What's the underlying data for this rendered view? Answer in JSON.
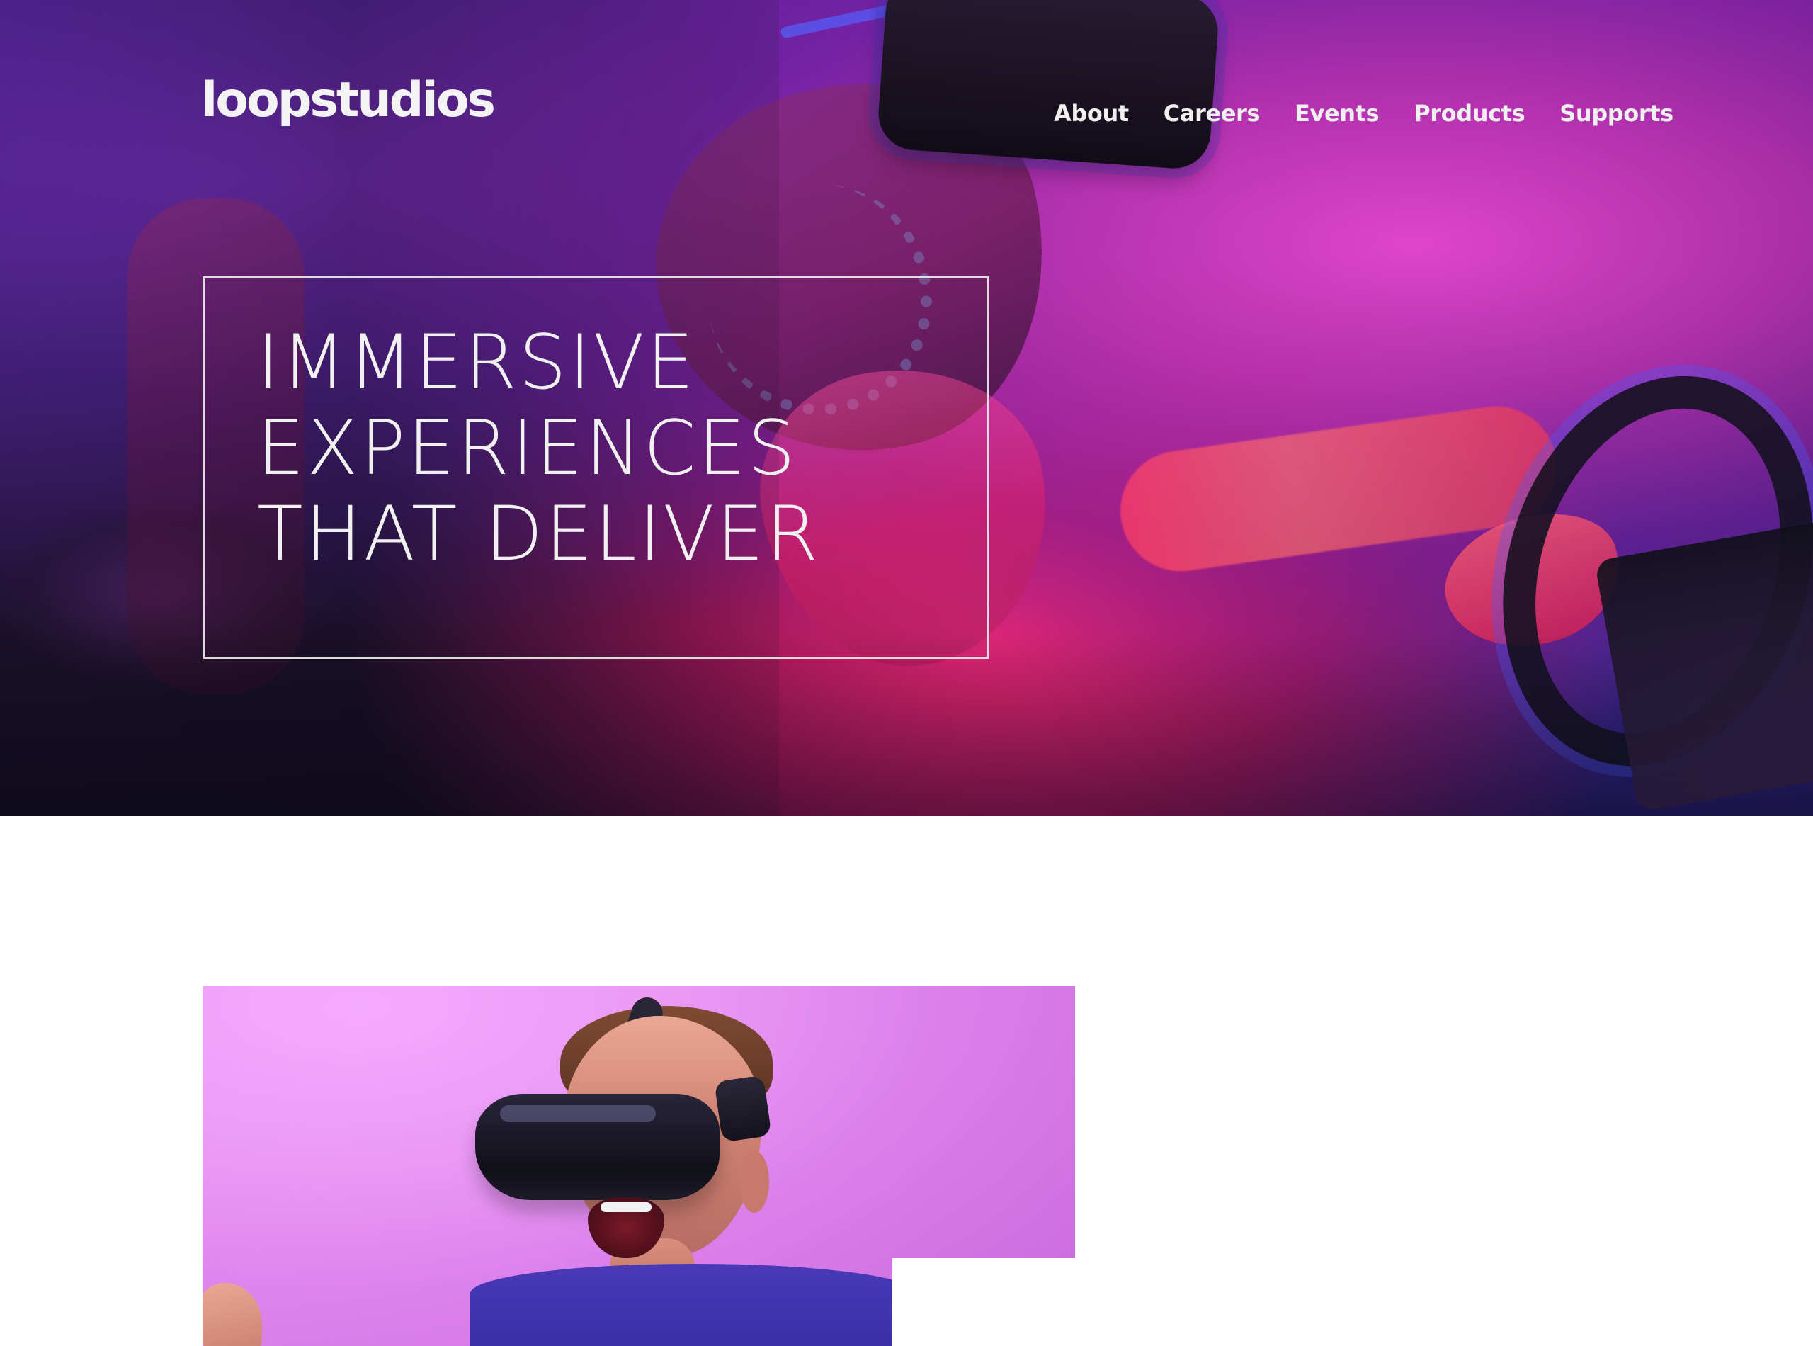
{
  "brand": {
    "logo_text": "loopstudios"
  },
  "nav": {
    "items": [
      {
        "label": "About"
      },
      {
        "label": "Careers"
      },
      {
        "label": "Events"
      },
      {
        "label": "Products"
      },
      {
        "label": "Supports"
      }
    ]
  },
  "hero": {
    "headline_lines": [
      "IMMERSIVE",
      "EXPERIENCES",
      "THAT DELIVER"
    ]
  },
  "colors": {
    "white": "#ffffff",
    "hero_text": "#f1f1f1",
    "magenta": "#d84adb",
    "purple": "#6b2cc2",
    "red": "#ff3f6c"
  }
}
